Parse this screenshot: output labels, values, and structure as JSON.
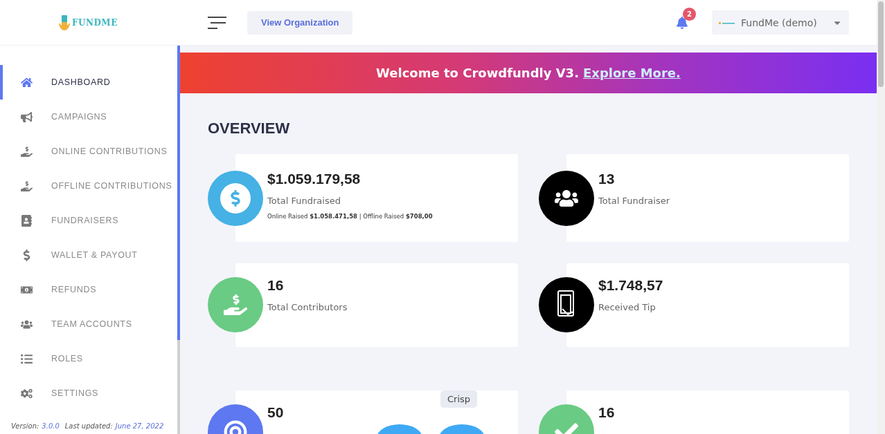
{
  "header": {
    "logo_text": "FUNDME",
    "view_button": "View Organization",
    "notifications": {
      "count": "2"
    },
    "org_select": {
      "value": "FundMe (demo)"
    }
  },
  "sidebar": {
    "items": [
      {
        "label": "DASHBOARD",
        "selected": true
      },
      {
        "label": "CAMPAIGNS",
        "selected": false
      },
      {
        "label": "ONLINE CONTRIBUTIONS",
        "selected": false
      },
      {
        "label": "OFFLINE CONTRIBUTIONS",
        "selected": false
      },
      {
        "label": "FUNDRAISERS",
        "selected": false
      },
      {
        "label": "WALLET & PAYOUT",
        "selected": false
      },
      {
        "label": "REFUNDS",
        "selected": false
      },
      {
        "label": "TEAM ACCOUNTS",
        "selected": false
      },
      {
        "label": "ROLES",
        "selected": false
      },
      {
        "label": "SETTINGS",
        "selected": false
      }
    ],
    "footer": {
      "version_label": "Version:",
      "version": "3.0.0",
      "updated_label": "Last updated:",
      "updated": "June 27, 2022"
    }
  },
  "banner": {
    "text": "Welcome to Crowdfundly V3.",
    "link": "Explore More."
  },
  "overview": {
    "title": "OVERVIEW",
    "stats": [
      {
        "value": "$1.059.179,58",
        "label": "Total Fundraised",
        "detail": "Online Raised **$1.058.471,58** | Offline Raised **$708,00**",
        "color": "#45b1e4"
      },
      {
        "value": "13",
        "label": "Total Fundraiser",
        "color": "#000000"
      },
      {
        "value": "16",
        "label": "Total Contributors",
        "color": "#6acb84"
      },
      {
        "value": "$1.748,57",
        "label": "Received Tip",
        "color": "#000000"
      },
      {
        "value": "50",
        "color": "#5d78f0"
      },
      {
        "value": "16",
        "color": "#6acb84"
      }
    ]
  },
  "chat_widget": {
    "tooltip": "Crisp"
  }
}
